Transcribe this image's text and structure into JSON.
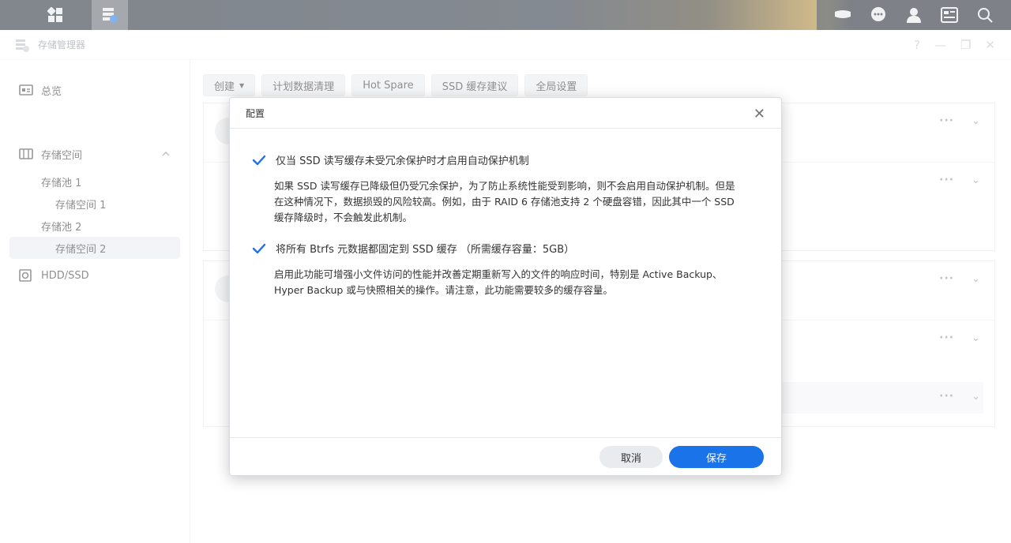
{
  "window": {
    "title": "存储管理器"
  },
  "sidebar": {
    "overview": "总览",
    "storage": "存储空间",
    "pool1": "存储池 1",
    "vol1": "存储空间 1",
    "pool2": "存储池 2",
    "vol2": "存储空间 2",
    "hdd": "HDD/SSD"
  },
  "toolbar": {
    "create": "创建",
    "schedule": "计划数据清理",
    "hotspare": "Hot Spare",
    "ssd_advice": "SSD 缓存建议",
    "global": "全局设置"
  },
  "dialog": {
    "title": "配置",
    "option1_label": "仅当 SSD 读写缓存未受冗余保护时才启用自动保护机制",
    "option1_desc_l1": "如果 SSD 读写缓存已降级但仍受冗余保护，为了防止系统性能受到影响，则不会启用自动保护机制。但是",
    "option1_desc_l2": "在这种情况下，数据损毁的风险较高。例如，由于 RAID 6 存储池支持 2 个硬盘容错，因此其中一个 SSD",
    "option1_desc_l3": "缓存降级时，不会触发此机制。",
    "option2_label": "将所有 Btrfs 元数据都固定到 SSD 缓存 （所需缓存容量：5GB）",
    "option2_desc_l1": "启用此功能可增强小文件访问的性能并改善定期重新写入的文件的响应时间，特别是 Active Backup、",
    "option2_desc_l2": "Hyper Backup 或与快照相关的操作。请注意，此功能需要较多的缓存容量。",
    "cancel": "取消",
    "save": "保存"
  },
  "colors": {
    "accent": "#1a73e8"
  }
}
